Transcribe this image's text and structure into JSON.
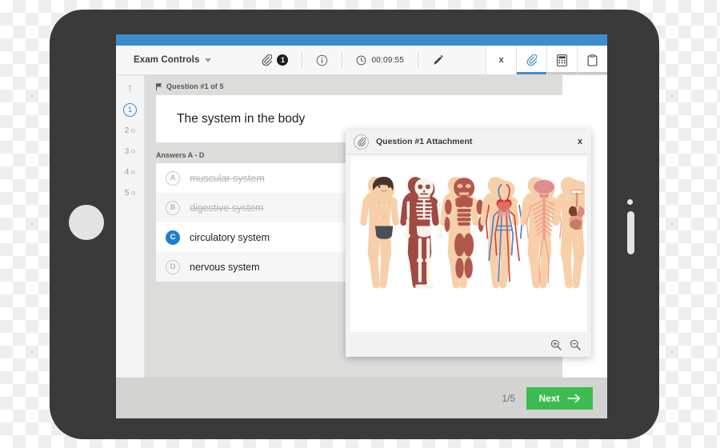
{
  "device": {
    "type": "tablet",
    "orientation": "landscape"
  },
  "toolbar": {
    "exam_controls_label": "Exam Controls",
    "dropdown_icon": "chevron-down-icon",
    "attachment_icon": "paperclip-icon",
    "attachment_count": "1",
    "info_icon": "info-circle-icon",
    "clock_icon": "clock-icon",
    "timer": "00:09:55",
    "pencil_icon": "pencil-icon",
    "right_tabs": [
      {
        "name": "close-tab",
        "icon": "x-icon",
        "label": "x",
        "active": false
      },
      {
        "name": "attachment-tab",
        "icon": "paperclip-icon",
        "label": "",
        "active": true
      },
      {
        "name": "calculator-tab",
        "icon": "calculator-icon",
        "label": "",
        "active": false
      },
      {
        "name": "notes-tab",
        "icon": "clipboard-icon",
        "label": "",
        "active": false
      }
    ]
  },
  "rail": {
    "up_arrow": "↑",
    "down_arrow": "↓",
    "items": [
      {
        "number": "1",
        "current": true
      },
      {
        "number": "2",
        "current": false
      },
      {
        "number": "3",
        "current": false
      },
      {
        "number": "4",
        "current": false
      },
      {
        "number": "5",
        "current": false
      }
    ]
  },
  "question": {
    "flag_icon": "flag-icon",
    "label": "Question #1 of 5",
    "text": "The system in the body",
    "answers_label": "Answers A - D",
    "answers": [
      {
        "letter": "A",
        "text": "muscular system",
        "state": "eliminated"
      },
      {
        "letter": "B",
        "text": "digestive system",
        "state": "eliminated"
      },
      {
        "letter": "C",
        "text": "circulatory system",
        "state": "selected"
      },
      {
        "letter": "D",
        "text": "nervous system",
        "state": "default"
      }
    ]
  },
  "modal": {
    "icon": "paperclip-icon",
    "title": "Question #1 Attachment",
    "close_label": "x",
    "zoom_in_icon": "zoom-in-icon",
    "zoom_out_icon": "zoom-out-icon",
    "figures": [
      {
        "name": "body-figure",
        "label": "body"
      },
      {
        "name": "skeletal-figure",
        "label": "skeletal system"
      },
      {
        "name": "muscular-figure",
        "label": "muscular system"
      },
      {
        "name": "circulatory-figure",
        "label": "circulatory system"
      },
      {
        "name": "nervous-figure",
        "label": "nervous system"
      },
      {
        "name": "digestive-figure",
        "label": "digestive system"
      }
    ]
  },
  "footer": {
    "page_count": "1/5",
    "next_label": "Next",
    "next_icon": "arrow-right-icon"
  },
  "colors": {
    "accent_blue": "#3d8dcc",
    "selected_blue": "#1e7fd0",
    "next_green": "#3cbc4f",
    "device_body": "#3a3a3a",
    "content_bg": "#dcdcda"
  }
}
